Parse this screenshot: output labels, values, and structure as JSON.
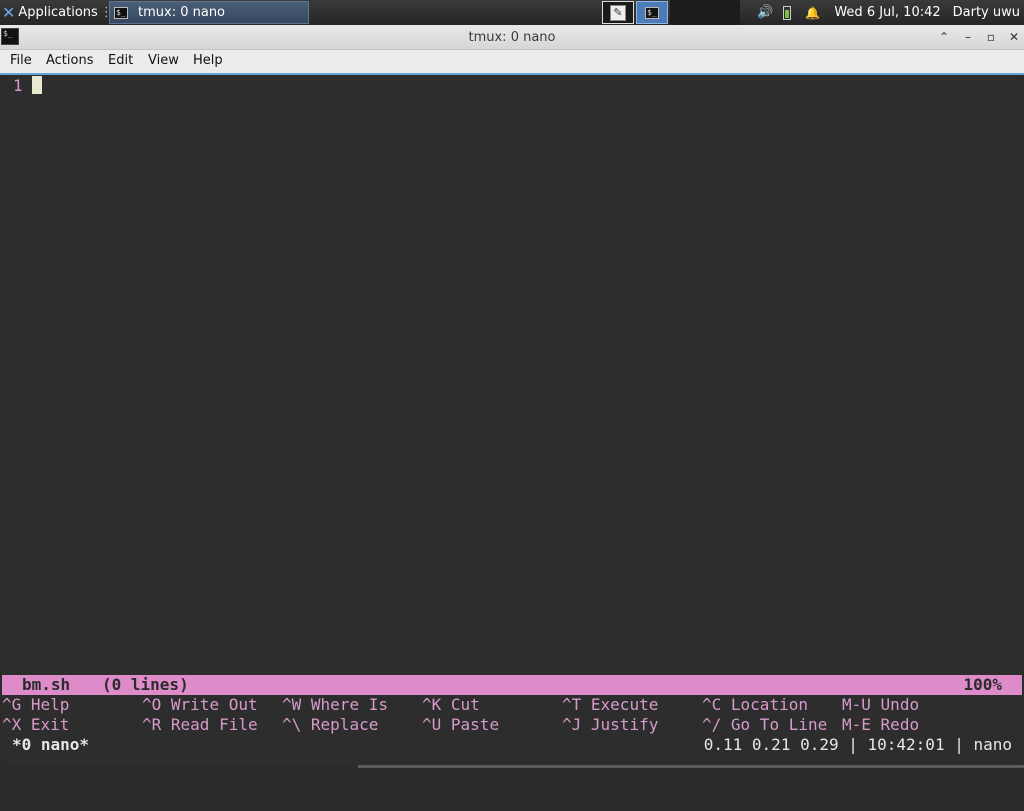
{
  "panel": {
    "applications_label": "Applications",
    "separator": "⋮",
    "task_label": "tmux: 0 nano",
    "clock": "Wed  6 Jul, 10:42",
    "user": "Darty uwu"
  },
  "window": {
    "title": "tmux: 0 nano"
  },
  "menu": {
    "items": [
      "File",
      "Actions",
      "Edit",
      "View",
      "Help"
    ]
  },
  "editor": {
    "line_number": "1",
    "filename": "bm.sh",
    "lines_info": "(0 lines)",
    "percent": "100%"
  },
  "shortcuts": {
    "row1": [
      {
        "key": "^G",
        "label": "Help"
      },
      {
        "key": "^O",
        "label": "Write Out"
      },
      {
        "key": "^W",
        "label": "Where Is"
      },
      {
        "key": "^K",
        "label": "Cut"
      },
      {
        "key": "^T",
        "label": "Execute"
      },
      {
        "key": "^C",
        "label": "Location"
      },
      {
        "key": "M-U",
        "label": "Undo"
      }
    ],
    "row2": [
      {
        "key": "^X",
        "label": "Exit"
      },
      {
        "key": "^R",
        "label": "Read File"
      },
      {
        "key": "^\\",
        "label": "Replace"
      },
      {
        "key": "^U",
        "label": "Paste"
      },
      {
        "key": "^J",
        "label": "Justify"
      },
      {
        "key": "^/",
        "label": "Go To Line"
      },
      {
        "key": "M-E",
        "label": "Redo"
      }
    ]
  },
  "tmux": {
    "window_label": "*0 nano*",
    "status_right": "0.11 0.21 0.29 | 10:42:01 | nano"
  },
  "colors": {
    "status_bar": "#dd8cc9",
    "shortcut_text": "#d79acb",
    "terminal_bg": "#2d2d2d"
  }
}
